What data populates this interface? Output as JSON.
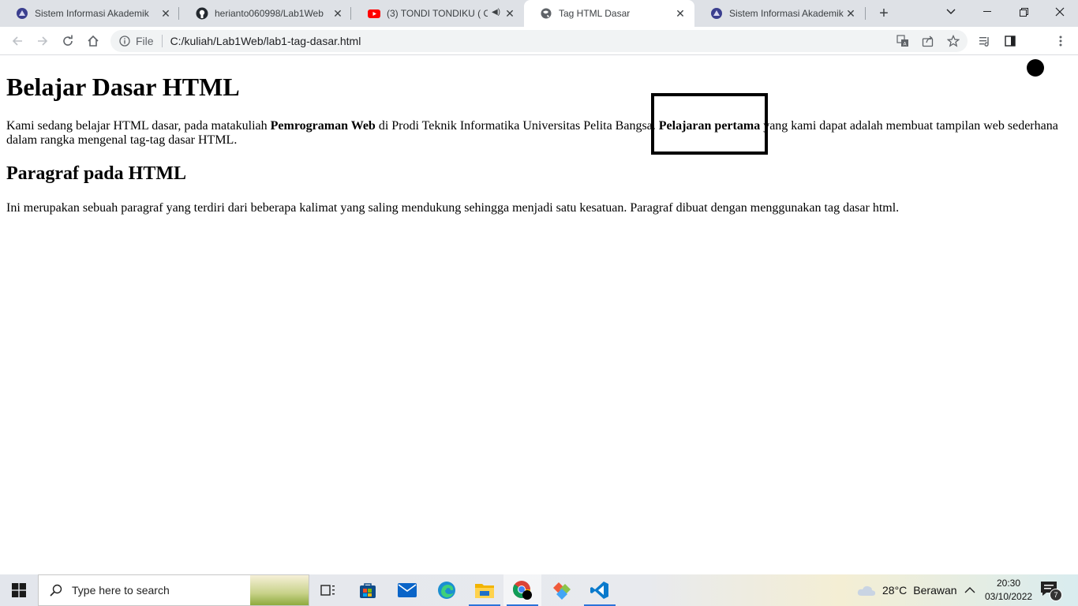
{
  "browser": {
    "tabs": [
      {
        "title": "Sistem Informasi Akademik",
        "icon": "university-icon"
      },
      {
        "title": "herianto060998/Lab1Web",
        "icon": "github-icon"
      },
      {
        "title": "(3) TONDI TONDIKU ( Offi",
        "icon": "youtube-icon"
      },
      {
        "title": "Tag HTML Dasar",
        "icon": "globe-icon"
      },
      {
        "title": "Sistem Informasi Akademik",
        "icon": "university-icon"
      }
    ],
    "omnibox": {
      "scheme_label": "File",
      "url": "C:/kuliah/Lab1Web/lab1-tag-dasar.html"
    }
  },
  "page": {
    "h1": "Belajar Dasar HTML",
    "p1": {
      "t1": "Kami sedang belajar HTML dasar, pada matakuliah ",
      "b1": "Pemrograman Web",
      "t2": " di Prodi Teknik Informatika Universitas Pelita Bangsa. ",
      "b2": "Pelajaran pertama",
      "t3": " yang kami dapat adalah membuat tampilan web sederhana dalam rangka mengenal tag-tag dasar HTML."
    },
    "h2": "Paragraf pada HTML",
    "p2": "Ini merupakan sebuah paragraf yang terdiri dari beberapa kalimat yang saling mendukung sehingga menjadi satu kesatuan. Paragraf dibuat dengan menggunakan tag dasar html."
  },
  "taskbar": {
    "search_placeholder": "Type here to search",
    "weather_temp": "28°C",
    "weather_text": "Berawan",
    "time": "20:30",
    "date": "03/10/2022",
    "notification_count": "7"
  },
  "colors": {
    "tabstrip_bg": "#dee1e6",
    "omnibox_bg": "#f1f3f4",
    "taskbar_running_indicator": "#2b73d9"
  }
}
